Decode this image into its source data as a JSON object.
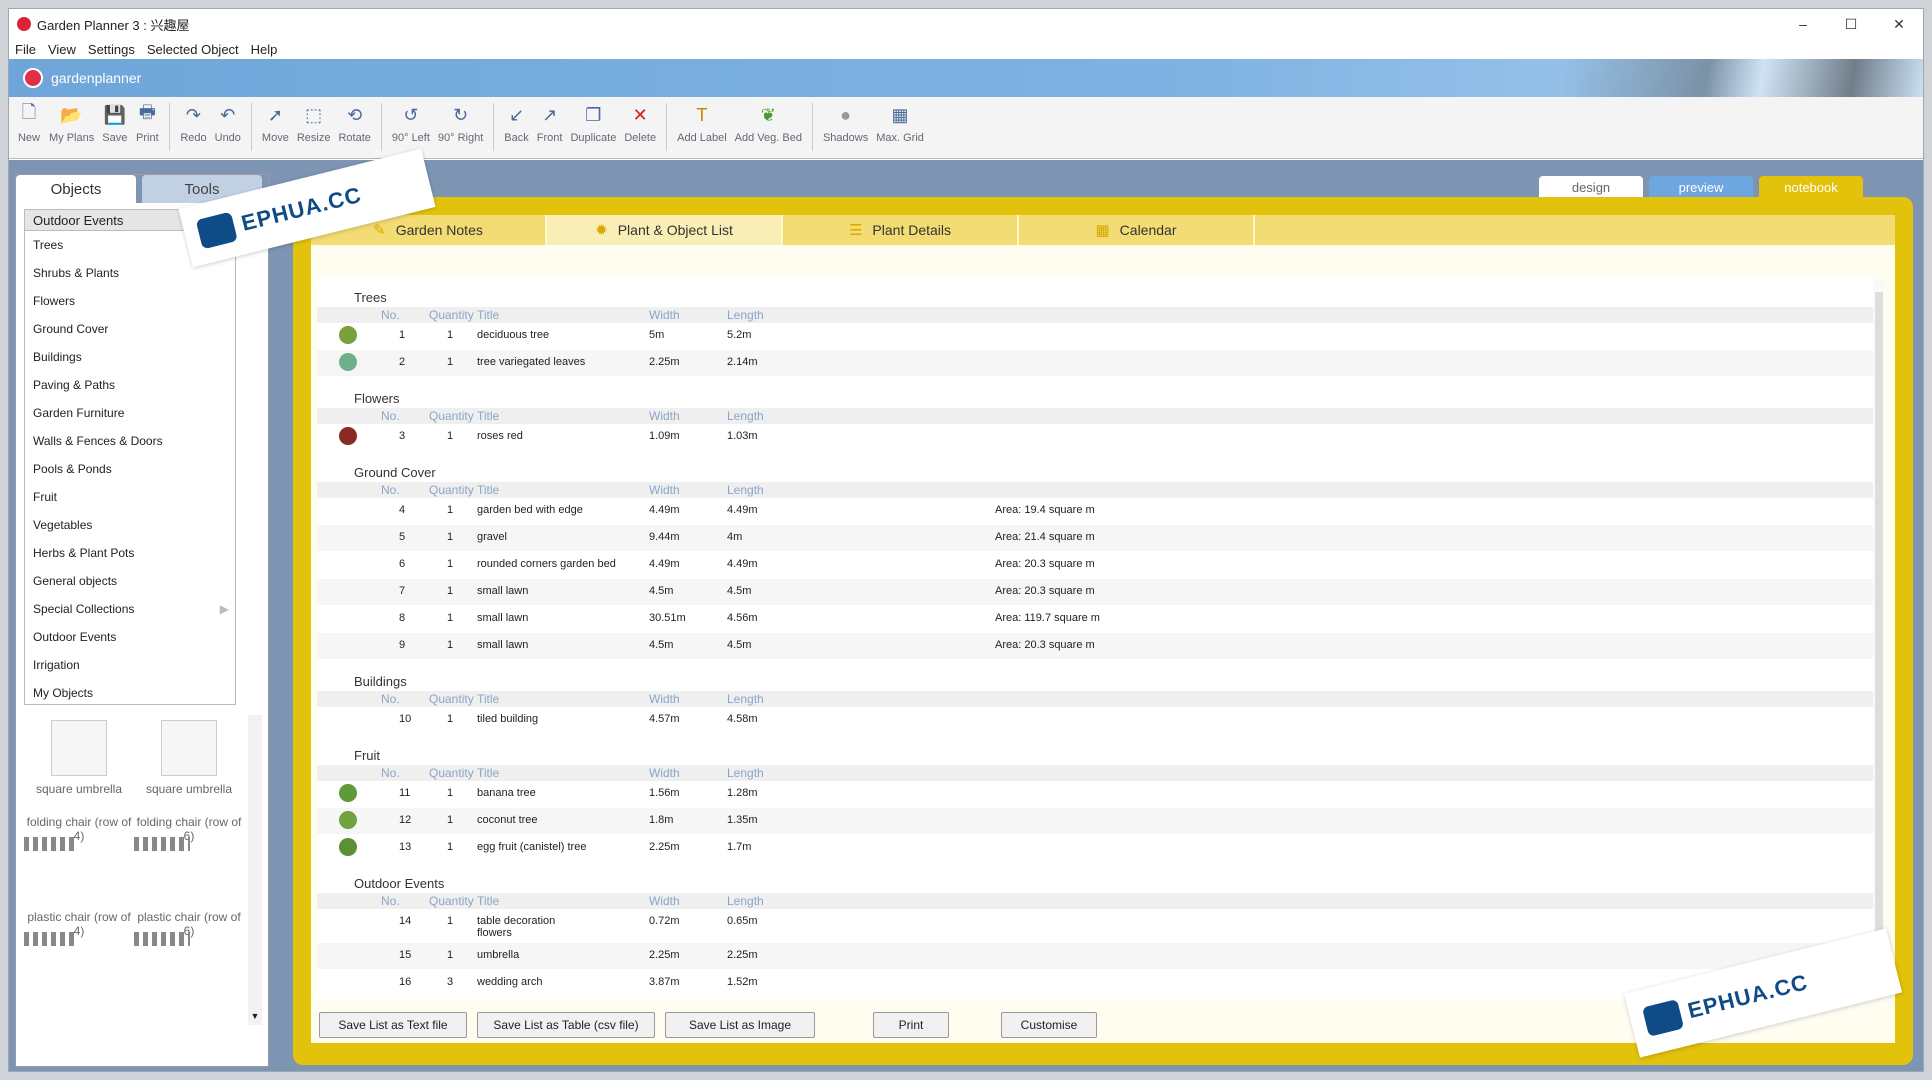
{
  "window": {
    "title": "Garden Planner 3 : 兴趣屋"
  },
  "window_controls": {
    "minimize": "–",
    "maximize": "☐",
    "close": "✕"
  },
  "menu": [
    "File",
    "View",
    "Settings",
    "Selected Object",
    "Help"
  ],
  "banner": {
    "brand": "gardenplanner"
  },
  "toolbar": [
    {
      "label": "New",
      "icon": "new-file-icon",
      "glyph": "🗋"
    },
    {
      "label": "My Plans",
      "icon": "folder-icon",
      "glyph": "📂"
    },
    {
      "label": "Save",
      "icon": "save-icon",
      "glyph": "💾"
    },
    {
      "label": "Print",
      "icon": "print-icon",
      "glyph": "🖶"
    },
    {
      "label": "Redo",
      "icon": "redo-icon",
      "glyph": "↷"
    },
    {
      "label": "Undo",
      "icon": "undo-icon",
      "glyph": "↶"
    },
    {
      "label": "Move",
      "icon": "cursor-icon",
      "glyph": "➚"
    },
    {
      "label": "Resize",
      "icon": "resize-icon",
      "glyph": "⬚"
    },
    {
      "label": "Rotate",
      "icon": "rotate-icon",
      "glyph": "⟲"
    },
    {
      "label": "90° Left",
      "icon": "rotate-left-icon",
      "glyph": "↺"
    },
    {
      "label": "90° Right",
      "icon": "rotate-right-icon",
      "glyph": "↻"
    },
    {
      "label": "Back",
      "icon": "send-back-icon",
      "glyph": "↙"
    },
    {
      "label": "Front",
      "icon": "bring-front-icon",
      "glyph": "↗"
    },
    {
      "label": "Duplicate",
      "icon": "duplicate-icon",
      "glyph": "❐"
    },
    {
      "label": "Delete",
      "icon": "delete-icon",
      "glyph": "✕"
    },
    {
      "label": "Add Label",
      "icon": "text-label-icon",
      "glyph": "T"
    },
    {
      "label": "Add Veg. Bed",
      "icon": "veg-bed-icon",
      "glyph": "❦"
    },
    {
      "label": "Shadows",
      "icon": "shadow-icon",
      "glyph": "●"
    },
    {
      "label": "Max. Grid",
      "icon": "grid-icon",
      "glyph": "▦"
    }
  ],
  "left_tabs": {
    "objects": "Objects",
    "tools": "Tools"
  },
  "category_selected": "Outdoor Events",
  "categories": [
    "Trees",
    "Shrubs & Plants",
    "Flowers",
    "Ground Cover",
    "Buildings",
    "Paving & Paths",
    "Garden Furniture",
    "Walls & Fences & Doors",
    "Pools & Ponds",
    "Fruit",
    "Vegetables",
    "Herbs & Plant Pots",
    "General objects",
    "Special Collections",
    "Outdoor Events",
    "Irrigation",
    "My Objects"
  ],
  "object_thumbs": [
    "square umbrella",
    "square umbrella",
    "folding chair (row of 4)",
    "folding chair (row of 6)",
    "plastic chair (row of 4)",
    "plastic chair (row of 6)"
  ],
  "view_tabs": {
    "design": "design",
    "preview": "preview",
    "notebook": "notebook"
  },
  "sub_tabs": [
    "Garden Notes",
    "Plant & Object List",
    "Plant Details",
    "Calendar"
  ],
  "columns": {
    "no": "No.",
    "quantity": "Quantity",
    "title": "Title",
    "width": "Width",
    "length": "Length"
  },
  "sections": [
    {
      "name": "Trees",
      "rows": [
        {
          "no": "1",
          "qty": "1",
          "title": "deciduous tree",
          "width": "5m",
          "length": "5.2m",
          "area": "",
          "icon_color": "#7aa03c"
        },
        {
          "no": "2",
          "qty": "1",
          "title": "tree variegated leaves",
          "width": "2.25m",
          "length": "2.14m",
          "area": "",
          "icon_color": "#6fb08a"
        }
      ]
    },
    {
      "name": "Flowers",
      "rows": [
        {
          "no": "3",
          "qty": "1",
          "title": "roses red",
          "width": "1.09m",
          "length": "1.03m",
          "area": "",
          "icon_color": "#8a2a20"
        }
      ]
    },
    {
      "name": "Ground Cover",
      "rows": [
        {
          "no": "4",
          "qty": "1",
          "title": "garden bed with edge",
          "width": "4.49m",
          "length": "4.49m",
          "area": "Area: 19.4 square m",
          "icon_color": ""
        },
        {
          "no": "5",
          "qty": "1",
          "title": "gravel",
          "width": "9.44m",
          "length": "4m",
          "area": "Area: 21.4 square m",
          "icon_color": ""
        },
        {
          "no": "6",
          "qty": "1",
          "title": "rounded corners garden bed",
          "width": "4.49m",
          "length": "4.49m",
          "area": "Area: 20.3 square m",
          "icon_color": ""
        },
        {
          "no": "7",
          "qty": "1",
          "title": "small lawn",
          "width": "4.5m",
          "length": "4.5m",
          "area": "Area: 20.3 square m",
          "icon_color": ""
        },
        {
          "no": "8",
          "qty": "1",
          "title": "small lawn",
          "width": "30.51m",
          "length": "4.56m",
          "area": "Area: 119.7 square m",
          "icon_color": ""
        },
        {
          "no": "9",
          "qty": "1",
          "title": "small lawn",
          "width": "4.5m",
          "length": "4.5m",
          "area": "Area: 20.3 square m",
          "icon_color": ""
        }
      ]
    },
    {
      "name": "Buildings",
      "rows": [
        {
          "no": "10",
          "qty": "1",
          "title": "tiled building",
          "width": "4.57m",
          "length": "4.58m",
          "area": "",
          "icon_color": ""
        }
      ]
    },
    {
      "name": "Fruit",
      "rows": [
        {
          "no": "11",
          "qty": "1",
          "title": "banana tree",
          "width": "1.56m",
          "length": "1.28m",
          "area": "",
          "icon_color": "#5f9a3a"
        },
        {
          "no": "12",
          "qty": "1",
          "title": "coconut  tree",
          "width": "1.8m",
          "length": "1.35m",
          "area": "",
          "icon_color": "#6fa33f"
        },
        {
          "no": "13",
          "qty": "1",
          "title": "egg fruit (canistel) tree",
          "width": "2.25m",
          "length": "1.7m",
          "area": "",
          "icon_color": "#5d8f35"
        }
      ]
    },
    {
      "name": "Outdoor Events",
      "rows": [
        {
          "no": "14",
          "qty": "1",
          "title": "table decoration\nflowers",
          "width": "0.72m",
          "length": "0.65m",
          "area": "",
          "icon_color": ""
        },
        {
          "no": "15",
          "qty": "1",
          "title": "umbrella",
          "width": "2.25m",
          "length": "2.25m",
          "area": "",
          "icon_color": ""
        },
        {
          "no": "16",
          "qty": "3",
          "title": "wedding arch",
          "width": "3.87m",
          "length": "1.52m",
          "area": "",
          "icon_color": ""
        }
      ]
    }
  ],
  "buttons": {
    "save_text": "Save List as Text file",
    "save_csv": "Save List as Table (csv file)",
    "save_image": "Save List as Image",
    "print": "Print",
    "customise": "Customise"
  },
  "watermark": {
    "text": "EPHUA.CC"
  },
  "colors": {
    "notebook_frame": "#e3c20b",
    "banner": "#6fa6d9",
    "header_text": "#8aa5c9",
    "accent_red": "#d9233b"
  }
}
